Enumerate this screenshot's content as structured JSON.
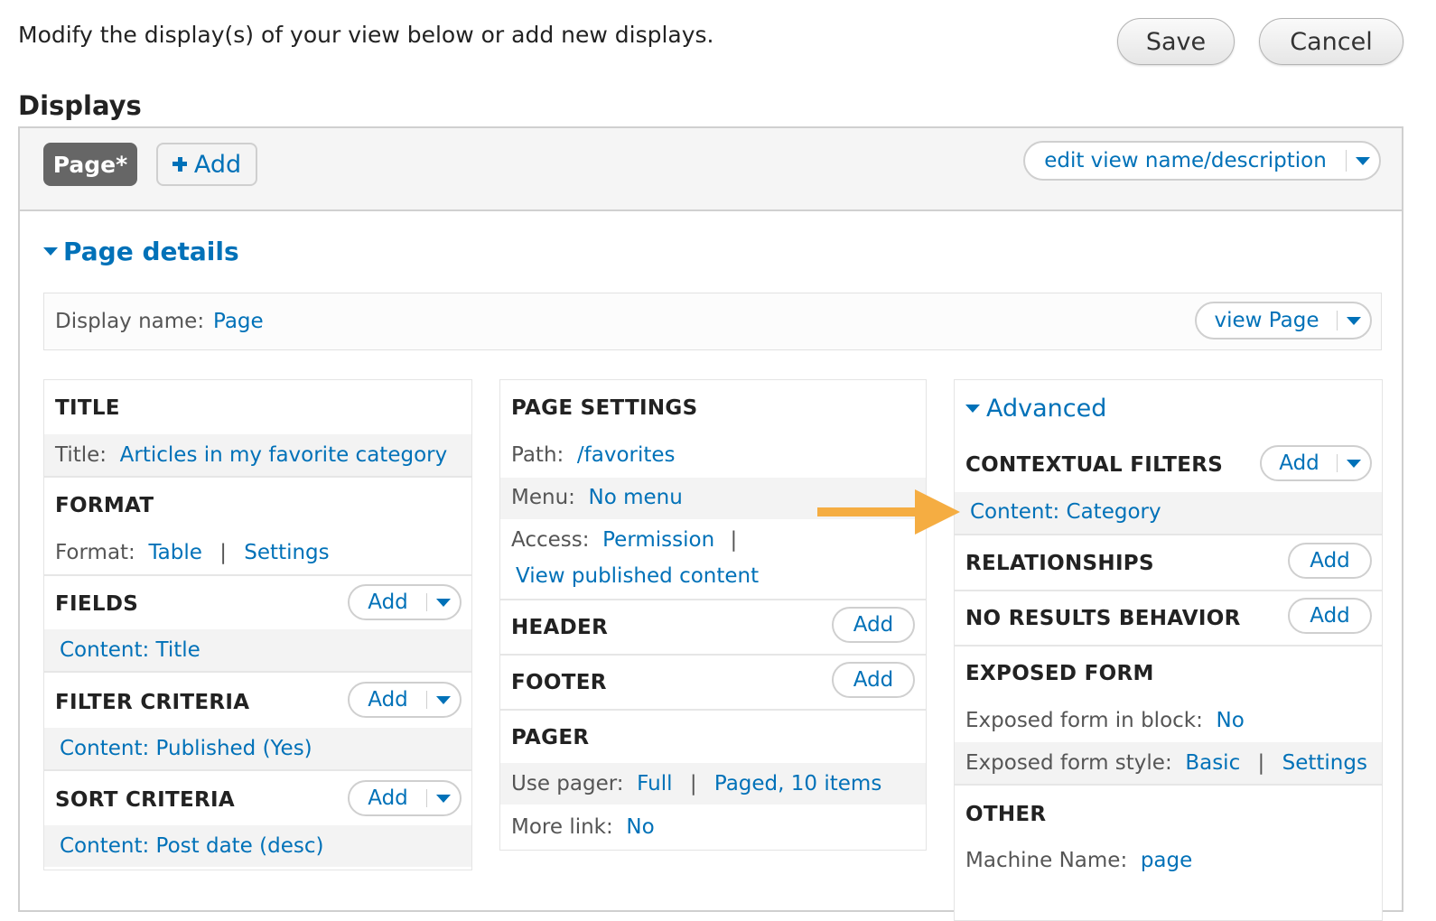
{
  "intro_text": "Modify the display(s) of your view below or add new displays.",
  "buttons": {
    "save": "Save",
    "cancel": "Cancel"
  },
  "displays_heading": "Displays",
  "tabs": {
    "page": "Page*",
    "add": "Add"
  },
  "edit_view_label": "edit view name/description",
  "page_details_label": "Page details",
  "display_name": {
    "label": "Display name:",
    "value": "Page"
  },
  "view_page_label": "view Page",
  "add_label": "Add",
  "left_col": {
    "title_header": "TITLE",
    "title_label": "Title:",
    "title_value": "Articles in my favorite category",
    "format_header": "FORMAT",
    "format_label": "Format:",
    "format_value": "Table",
    "format_settings": "Settings",
    "fields_header": "FIELDS",
    "fields_value": "Content: Title",
    "filter_header": "FILTER CRITERIA",
    "filter_value": "Content: Published (Yes)",
    "sort_header": "SORT CRITERIA",
    "sort_value": "Content: Post date (desc)"
  },
  "mid_col": {
    "page_settings_header": "PAGE SETTINGS",
    "path_label": "Path:",
    "path_value": "/favorites",
    "menu_label": "Menu:",
    "menu_value": "No menu",
    "access_label": "Access:",
    "access_value": "Permission",
    "access_value2": "View published content",
    "header_header": "HEADER",
    "footer_header": "FOOTER",
    "pager_header": "PAGER",
    "use_pager_label": "Use pager:",
    "use_pager_value": "Full",
    "use_pager_value2": "Paged, 10 items",
    "more_link_label": "More link:",
    "more_link_value": "No"
  },
  "right_col": {
    "advanced_label": "Advanced",
    "contextual_header": "CONTEXTUAL FILTERS",
    "contextual_value": "Content: Category",
    "relationships_header": "RELATIONSHIPS",
    "no_results_header": "NO RESULTS BEHAVIOR",
    "exposed_form_header": "EXPOSED FORM",
    "exposed_block_label": "Exposed form in block:",
    "exposed_block_value": "No",
    "exposed_style_label": "Exposed form style:",
    "exposed_style_value": "Basic",
    "exposed_style_settings": "Settings",
    "other_header": "OTHER",
    "machine_name_label": "Machine Name:",
    "machine_name_value": "page"
  },
  "separator": "|",
  "colors": {
    "link": "#0071b8",
    "arrow": "#f5ad42",
    "active_tab": "#666666"
  }
}
